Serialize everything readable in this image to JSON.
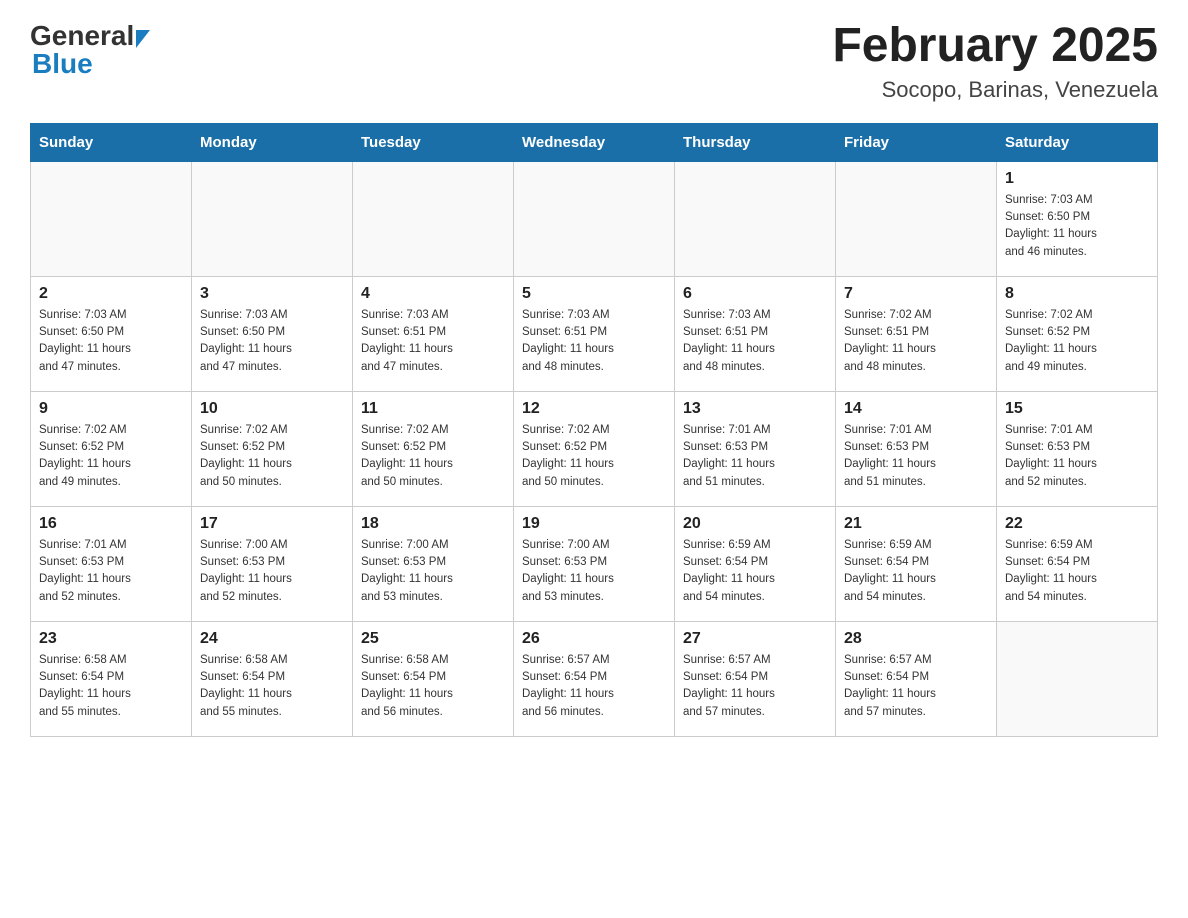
{
  "header": {
    "logo_general": "General",
    "logo_blue": "Blue",
    "month_title": "February 2025",
    "location": "Socopo, Barinas, Venezuela"
  },
  "calendar": {
    "days_of_week": [
      "Sunday",
      "Monday",
      "Tuesday",
      "Wednesday",
      "Thursday",
      "Friday",
      "Saturday"
    ],
    "weeks": [
      [
        {
          "day": "",
          "info": ""
        },
        {
          "day": "",
          "info": ""
        },
        {
          "day": "",
          "info": ""
        },
        {
          "day": "",
          "info": ""
        },
        {
          "day": "",
          "info": ""
        },
        {
          "day": "",
          "info": ""
        },
        {
          "day": "1",
          "info": "Sunrise: 7:03 AM\nSunset: 6:50 PM\nDaylight: 11 hours\nand 46 minutes."
        }
      ],
      [
        {
          "day": "2",
          "info": "Sunrise: 7:03 AM\nSunset: 6:50 PM\nDaylight: 11 hours\nand 47 minutes."
        },
        {
          "day": "3",
          "info": "Sunrise: 7:03 AM\nSunset: 6:50 PM\nDaylight: 11 hours\nand 47 minutes."
        },
        {
          "day": "4",
          "info": "Sunrise: 7:03 AM\nSunset: 6:51 PM\nDaylight: 11 hours\nand 47 minutes."
        },
        {
          "day": "5",
          "info": "Sunrise: 7:03 AM\nSunset: 6:51 PM\nDaylight: 11 hours\nand 48 minutes."
        },
        {
          "day": "6",
          "info": "Sunrise: 7:03 AM\nSunset: 6:51 PM\nDaylight: 11 hours\nand 48 minutes."
        },
        {
          "day": "7",
          "info": "Sunrise: 7:02 AM\nSunset: 6:51 PM\nDaylight: 11 hours\nand 48 minutes."
        },
        {
          "day": "8",
          "info": "Sunrise: 7:02 AM\nSunset: 6:52 PM\nDaylight: 11 hours\nand 49 minutes."
        }
      ],
      [
        {
          "day": "9",
          "info": "Sunrise: 7:02 AM\nSunset: 6:52 PM\nDaylight: 11 hours\nand 49 minutes."
        },
        {
          "day": "10",
          "info": "Sunrise: 7:02 AM\nSunset: 6:52 PM\nDaylight: 11 hours\nand 50 minutes."
        },
        {
          "day": "11",
          "info": "Sunrise: 7:02 AM\nSunset: 6:52 PM\nDaylight: 11 hours\nand 50 minutes."
        },
        {
          "day": "12",
          "info": "Sunrise: 7:02 AM\nSunset: 6:52 PM\nDaylight: 11 hours\nand 50 minutes."
        },
        {
          "day": "13",
          "info": "Sunrise: 7:01 AM\nSunset: 6:53 PM\nDaylight: 11 hours\nand 51 minutes."
        },
        {
          "day": "14",
          "info": "Sunrise: 7:01 AM\nSunset: 6:53 PM\nDaylight: 11 hours\nand 51 minutes."
        },
        {
          "day": "15",
          "info": "Sunrise: 7:01 AM\nSunset: 6:53 PM\nDaylight: 11 hours\nand 52 minutes."
        }
      ],
      [
        {
          "day": "16",
          "info": "Sunrise: 7:01 AM\nSunset: 6:53 PM\nDaylight: 11 hours\nand 52 minutes."
        },
        {
          "day": "17",
          "info": "Sunrise: 7:00 AM\nSunset: 6:53 PM\nDaylight: 11 hours\nand 52 minutes."
        },
        {
          "day": "18",
          "info": "Sunrise: 7:00 AM\nSunset: 6:53 PM\nDaylight: 11 hours\nand 53 minutes."
        },
        {
          "day": "19",
          "info": "Sunrise: 7:00 AM\nSunset: 6:53 PM\nDaylight: 11 hours\nand 53 minutes."
        },
        {
          "day": "20",
          "info": "Sunrise: 6:59 AM\nSunset: 6:54 PM\nDaylight: 11 hours\nand 54 minutes."
        },
        {
          "day": "21",
          "info": "Sunrise: 6:59 AM\nSunset: 6:54 PM\nDaylight: 11 hours\nand 54 minutes."
        },
        {
          "day": "22",
          "info": "Sunrise: 6:59 AM\nSunset: 6:54 PM\nDaylight: 11 hours\nand 54 minutes."
        }
      ],
      [
        {
          "day": "23",
          "info": "Sunrise: 6:58 AM\nSunset: 6:54 PM\nDaylight: 11 hours\nand 55 minutes."
        },
        {
          "day": "24",
          "info": "Sunrise: 6:58 AM\nSunset: 6:54 PM\nDaylight: 11 hours\nand 55 minutes."
        },
        {
          "day": "25",
          "info": "Sunrise: 6:58 AM\nSunset: 6:54 PM\nDaylight: 11 hours\nand 56 minutes."
        },
        {
          "day": "26",
          "info": "Sunrise: 6:57 AM\nSunset: 6:54 PM\nDaylight: 11 hours\nand 56 minutes."
        },
        {
          "day": "27",
          "info": "Sunrise: 6:57 AM\nSunset: 6:54 PM\nDaylight: 11 hours\nand 57 minutes."
        },
        {
          "day": "28",
          "info": "Sunrise: 6:57 AM\nSunset: 6:54 PM\nDaylight: 11 hours\nand 57 minutes."
        },
        {
          "day": "",
          "info": ""
        }
      ]
    ]
  }
}
